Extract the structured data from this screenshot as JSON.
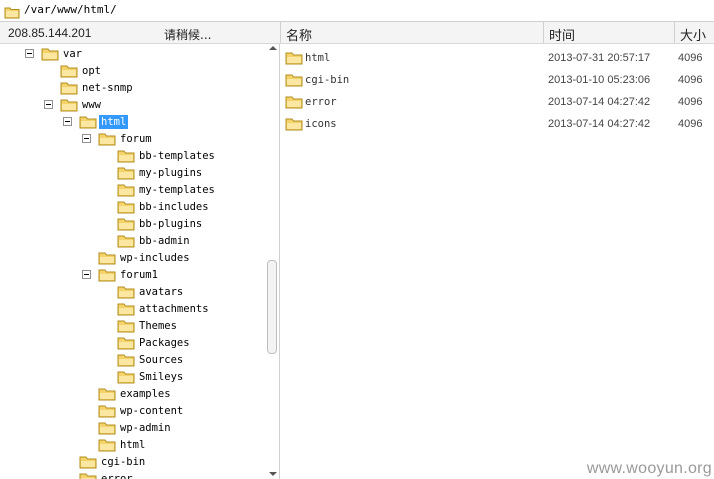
{
  "path": "/var/www/html/",
  "header": {
    "ip": "208.85.144.201",
    "status": "请稍候...",
    "col_name": "名称",
    "col_time": "时间",
    "col_size": "大小"
  },
  "tree": [
    {
      "label": "var",
      "depth": 0,
      "expanded": true
    },
    {
      "label": "opt",
      "depth": 1
    },
    {
      "label": "net-snmp",
      "depth": 1
    },
    {
      "label": "www",
      "depth": 1,
      "expanded": true
    },
    {
      "label": "html",
      "depth": 2,
      "expanded": true,
      "selected": true
    },
    {
      "label": "forum",
      "depth": 3,
      "expanded": true
    },
    {
      "label": "bb-templates",
      "depth": 4
    },
    {
      "label": "my-plugins",
      "depth": 4
    },
    {
      "label": "my-templates",
      "depth": 4
    },
    {
      "label": "bb-includes",
      "depth": 4
    },
    {
      "label": "bb-plugins",
      "depth": 4
    },
    {
      "label": "bb-admin",
      "depth": 4
    },
    {
      "label": "wp-includes",
      "depth": 3
    },
    {
      "label": "forum1",
      "depth": 3,
      "expanded": true
    },
    {
      "label": "avatars",
      "depth": 4
    },
    {
      "label": "attachments",
      "depth": 4
    },
    {
      "label": "Themes",
      "depth": 4
    },
    {
      "label": "Packages",
      "depth": 4
    },
    {
      "label": "Sources",
      "depth": 4
    },
    {
      "label": "Smileys",
      "depth": 4
    },
    {
      "label": "examples",
      "depth": 3
    },
    {
      "label": "wp-content",
      "depth": 3
    },
    {
      "label": "wp-admin",
      "depth": 3
    },
    {
      "label": "html",
      "depth": 3
    },
    {
      "label": "cgi-bin",
      "depth": 2
    },
    {
      "label": "error",
      "depth": 2
    }
  ],
  "files": [
    {
      "name": "html",
      "time": "2013-07-31 20:57:17",
      "size": "4096"
    },
    {
      "name": "cgi-bin",
      "time": "2013-01-10 05:23:06",
      "size": "4096"
    },
    {
      "name": "error",
      "time": "2013-07-14 04:27:42",
      "size": "4096"
    },
    {
      "name": "icons",
      "time": "2013-07-14 04:27:42",
      "size": "4096"
    }
  ],
  "watermark": "www.wooyun.org",
  "colors": {
    "folder": "#f3d36a",
    "folder_edge": "#b08d1e",
    "selection": "#3399ff"
  },
  "icons": {
    "folder": "folder-icon",
    "toggle": "collapse-toggle-icon"
  }
}
